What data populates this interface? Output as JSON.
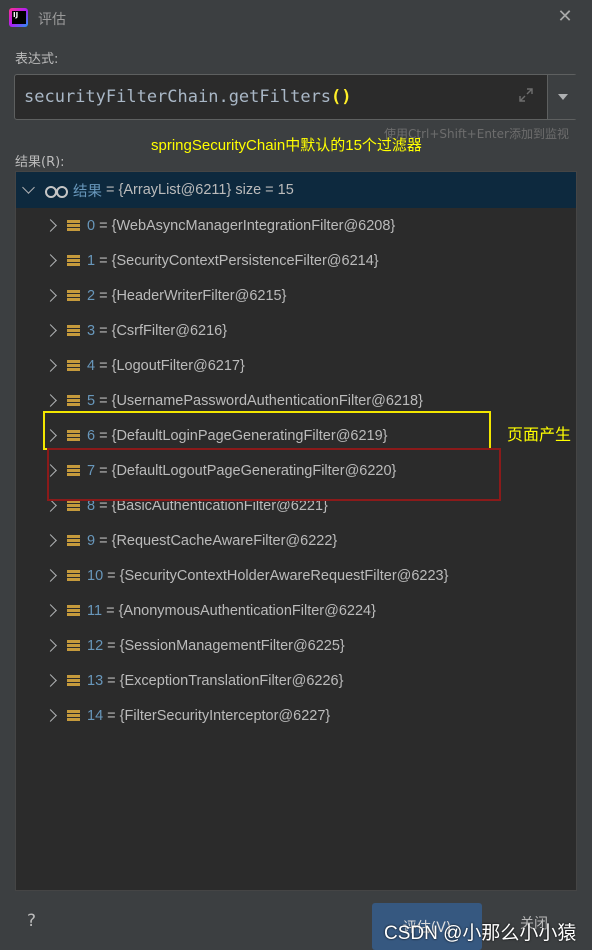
{
  "window": {
    "title": "评估",
    "close_glyph": "✕"
  },
  "expression": {
    "label": "表达式:",
    "value": "securityFilterChain.getFilters",
    "parens": "()",
    "hint": "使用Ctrl+Shift+Enter添加到监视"
  },
  "annotations": {
    "top": "springSecurityChain中默认的15个过滤器",
    "side": "页面产生",
    "highlight_yellow_index": 6,
    "highlight_red_index": 7,
    "colors": {
      "yellow": "#f2e600",
      "red": "#8b1a1a"
    }
  },
  "result": {
    "label": "结果(R):",
    "root": {
      "name": "结果",
      "value": "{ArrayList@6211}  size = 15"
    },
    "items": [
      {
        "index": "0",
        "value": "{WebAsyncManagerIntegrationFilter@6208}"
      },
      {
        "index": "1",
        "value": "{SecurityContextPersistenceFilter@6214}"
      },
      {
        "index": "2",
        "value": "{HeaderWriterFilter@6215}"
      },
      {
        "index": "3",
        "value": "{CsrfFilter@6216}"
      },
      {
        "index": "4",
        "value": "{LogoutFilter@6217}"
      },
      {
        "index": "5",
        "value": "{UsernamePasswordAuthenticationFilter@6218}"
      },
      {
        "index": "6",
        "value": "{DefaultLoginPageGeneratingFilter@6219}"
      },
      {
        "index": "7",
        "value": "{DefaultLogoutPageGeneratingFilter@6220}"
      },
      {
        "index": "8",
        "value": "{BasicAuthenticationFilter@6221}"
      },
      {
        "index": "9",
        "value": "{RequestCacheAwareFilter@6222}"
      },
      {
        "index": "10",
        "value": "{SecurityContextHolderAwareRequestFilter@6223}"
      },
      {
        "index": "11",
        "value": "{AnonymousAuthenticationFilter@6224}"
      },
      {
        "index": "12",
        "value": "{SessionManagementFilter@6225}"
      },
      {
        "index": "13",
        "value": "{ExceptionTranslationFilter@6226}"
      },
      {
        "index": "14",
        "value": "{FilterSecurityInterceptor@6227}"
      }
    ]
  },
  "footer": {
    "help": "?",
    "evaluate": "评估(V)",
    "close": "关闭",
    "watermark": "CSDN @小那么小小猿"
  }
}
